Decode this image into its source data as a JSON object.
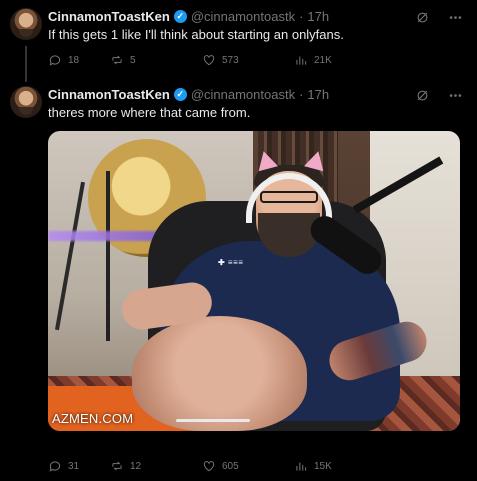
{
  "colors": {
    "background": "#000000",
    "text": "#e7e9ea",
    "muted": "#71767b",
    "verified": "#1d9bf0"
  },
  "tweets": [
    {
      "author": {
        "name": "CinnamonToastKen",
        "handle": "@cinnamontoastk",
        "verified_icon": "verified-badge-icon"
      },
      "separator": "·",
      "time": "17h",
      "text": "If this gets 1 like I'll think about starting an onlyfans.",
      "stats": {
        "replies": "18",
        "reposts": "5",
        "likes": "573",
        "views": "21K"
      }
    },
    {
      "author": {
        "name": "CinnamonToastKen",
        "handle": "@cinnamontoastk",
        "verified_icon": "verified-badge-icon"
      },
      "separator": "·",
      "time": "17h",
      "text": "theres more where that came from.",
      "media": {
        "watermark": "AZMEN.COM",
        "progress_fraction": 0.35
      },
      "stats": {
        "replies": "31",
        "reposts": "12",
        "likes": "605",
        "views": "15K"
      }
    }
  ]
}
